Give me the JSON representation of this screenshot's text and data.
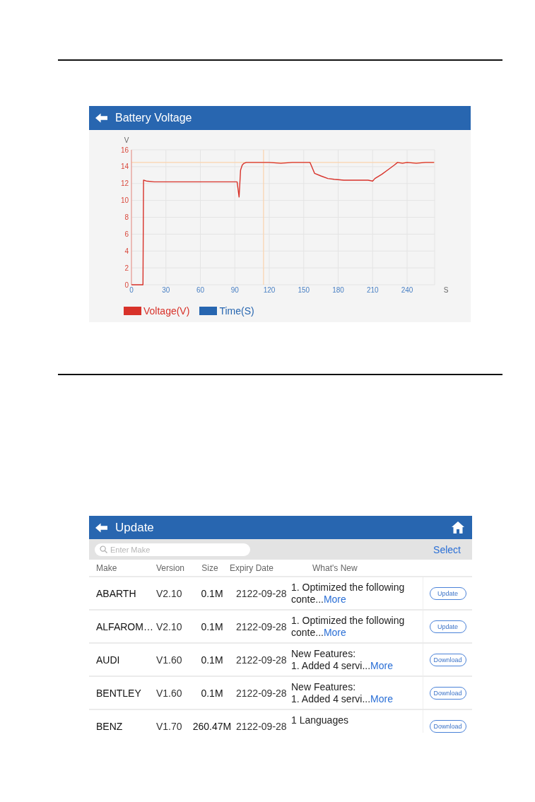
{
  "battery_screen": {
    "title": "Battery Voltage",
    "chart_data": {
      "type": "line",
      "xlabel": "S",
      "ylabel": "V",
      "grid": true,
      "x": [
        0,
        10,
        10.5,
        13,
        20,
        30,
        45,
        60,
        75,
        88,
        92,
        93.7,
        95,
        96.5,
        98,
        100,
        110,
        120,
        130,
        140,
        150,
        155.5,
        159.5,
        165,
        171,
        176.5,
        185,
        192,
        200,
        206,
        210,
        212,
        218,
        224,
        229,
        231.7,
        236,
        240,
        248,
        256,
        263.5
      ],
      "series": [
        {
          "name": "Voltage(V)",
          "color": "#d8322a",
          "values": [
            0,
            0,
            12.4,
            12.3,
            12.2,
            12.2,
            12.2,
            12.2,
            12.2,
            12.2,
            12.2,
            10.4,
            13.6,
            14.2,
            14.4,
            14.5,
            14.5,
            14.5,
            14.4,
            14.5,
            14.5,
            14.5,
            13.2,
            12.9,
            12.6,
            12.5,
            12.4,
            12.4,
            12.4,
            12.4,
            12.3,
            12.6,
            13.1,
            13.7,
            14.2,
            14.5,
            14.4,
            14.5,
            14.4,
            14.5,
            14.5
          ]
        }
      ],
      "xlim": [
        0,
        264
      ],
      "ylim": [
        0,
        16
      ],
      "xticks": [
        0,
        30,
        60,
        90,
        120,
        150,
        180,
        210,
        240
      ],
      "yticks": [
        0,
        2,
        4,
        6,
        8,
        10,
        12,
        14,
        16
      ],
      "ref_lines": [
        {
          "axis": "y",
          "value": 14.5
        },
        {
          "axis": "x",
          "value": 115
        }
      ]
    },
    "time_legend": {
      "label": "Time(S)",
      "color": "#2766b0"
    }
  },
  "update_screen": {
    "title": "Update",
    "search": {
      "placeholder": "Enter Make"
    },
    "select_label": "Select",
    "columns": [
      "Make",
      "Version",
      "Size",
      "Expiry Date",
      "What's New"
    ],
    "rows": [
      {
        "make": "ABARTH",
        "version": "V2.10",
        "size": "0.1M",
        "expiry": "2122-09-28",
        "whats_new": "1. Optimized the following conte...",
        "more": "More",
        "button": "Update"
      },
      {
        "make": "ALFAROM…",
        "version": "V2.10",
        "size": "0.1M",
        "expiry": "2122-09-28",
        "whats_new": "1. Optimized the following conte...",
        "more": "More",
        "button": "Update"
      },
      {
        "make": "AUDI",
        "version": "V1.60",
        "size": "0.1M",
        "expiry": "2122-09-28",
        "whats_new": "New Features:\n1. Added 4 servi...",
        "more": "More",
        "button": "Download"
      },
      {
        "make": "BENTLEY",
        "version": "V1.60",
        "size": "0.1M",
        "expiry": "2122-09-28",
        "whats_new": "New Features:\n1. Added 4 servi...",
        "more": "More",
        "button": "Download"
      },
      {
        "make": "BENZ",
        "version": "V1.70",
        "size": "260.47M",
        "expiry": "2122-09-28",
        "whats_new": "1 Languages",
        "button": "Download"
      }
    ]
  }
}
